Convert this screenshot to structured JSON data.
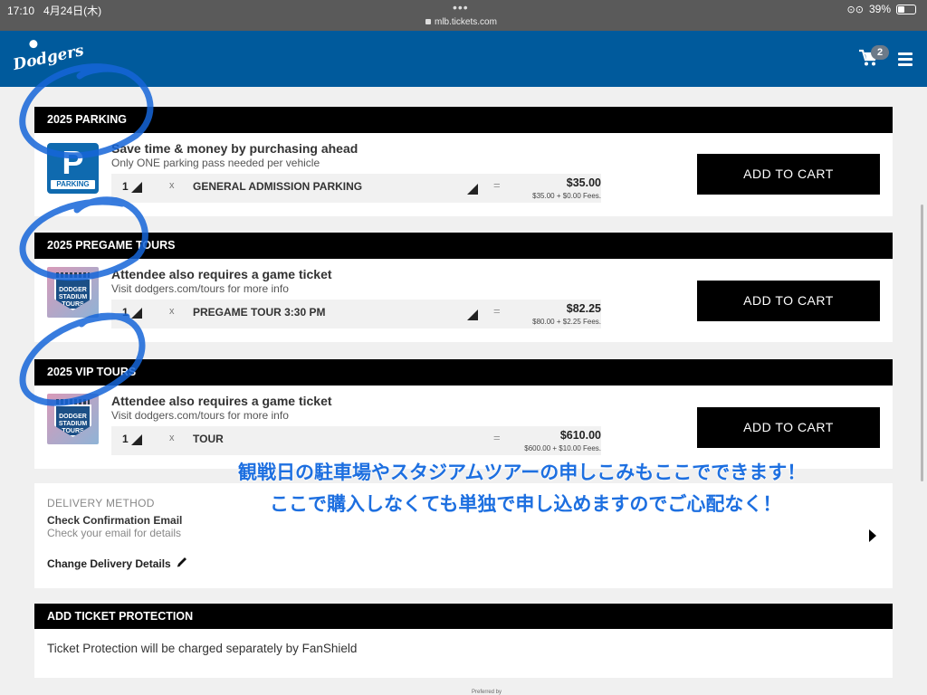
{
  "status_bar": {
    "time": "17:10",
    "date": "4月24日(木)",
    "url": "mlb.tickets.com",
    "battery": "39%"
  },
  "header": {
    "logo_text": "Dodgers",
    "cart_count": "2",
    "brand_color": "#005a9c"
  },
  "sections": [
    {
      "heading": "2025 PARKING",
      "title": "Save time & money by purchasing ahead",
      "subtitle": "Only ONE parking pass needed per vehicle",
      "icon": "parking-icon",
      "icon_text": "P",
      "icon_label": "PARKING",
      "quantity": "1",
      "multiplier": "x",
      "item": "GENERAL ADMISSION PARKING",
      "equals": "=",
      "price": "$35.00",
      "fees": "$35.00 + $0.00 Fees.",
      "button": "ADD TO CART"
    },
    {
      "heading": "2025 PREGAME TOURS",
      "title": "Attendee also requires a game ticket",
      "subtitle": "Visit dodgers.com/tours for more info",
      "icon": "dodger-stadium-tours-icon",
      "icon_text": "DODGER STADIUM TOURS",
      "quantity": "1",
      "multiplier": "x",
      "item": "PREGAME TOUR 3:30 PM",
      "equals": "=",
      "price": "$82.25",
      "fees": "$80.00 + $2.25 Fees.",
      "button": "ADD TO CART"
    },
    {
      "heading": "2025 VIP TOURS",
      "title": "Attendee also requires a game ticket",
      "subtitle": "Visit dodgers.com/tours for more info",
      "icon": "dodger-stadium-tours-icon",
      "icon_text": "DODGER STADIUM TOURS",
      "quantity": "1",
      "multiplier": "x",
      "item": "TOUR",
      "equals": "=",
      "price": "$610.00",
      "fees": "$600.00 + $10.00 Fees.",
      "button": "ADD TO CART"
    }
  ],
  "annotation": {
    "line1": "観戦日の駐車場やスタジアムツアーの申しこみもここでできます！",
    "line2": "ここで購入しなくても単独で申し込めますのでご心配なく！",
    "color": "#1d6fe0"
  },
  "delivery": {
    "label": "DELIVERY METHOD",
    "title": "Check Confirmation Email",
    "subtitle": "Check your email for details",
    "change": "Change Delivery Details"
  },
  "protection": {
    "heading": "ADD TICKET PROTECTION",
    "text": "Ticket Protection will be charged separately by FanShield"
  },
  "footer": {
    "preferred": "Preferred by"
  }
}
